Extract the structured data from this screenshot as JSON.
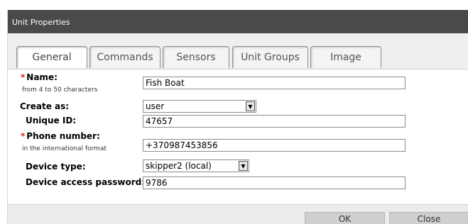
{
  "dialog": {
    "title": "Unit Properties"
  },
  "tabs": [
    {
      "label": "General"
    },
    {
      "label": "Commands"
    },
    {
      "label": "Sensors"
    },
    {
      "label": "Unit Groups"
    },
    {
      "label": "Image"
    }
  ],
  "form": {
    "name": {
      "label": "Name:",
      "hint": "from 4 to 50 characters",
      "value": "Fish Boat",
      "required_mark": "*"
    },
    "create_as": {
      "label": "Create as:",
      "value": "user"
    },
    "unique_id": {
      "label": "Unique ID:",
      "value": "47657"
    },
    "phone": {
      "label": "Phone number:",
      "hint": "in the international format",
      "value": "+370987453856",
      "required_mark": "*"
    },
    "device_type": {
      "label": "Device type:",
      "value": "skipper2 (local)"
    },
    "password": {
      "label": "Device access password:",
      "value": "9786"
    }
  },
  "buttons": {
    "ok": "OK",
    "close": "Close"
  },
  "colors": {
    "titlebar": "#4a4a4a",
    "required": "#d22222"
  },
  "icons": {
    "dropdown": "chevron-down-icon"
  }
}
